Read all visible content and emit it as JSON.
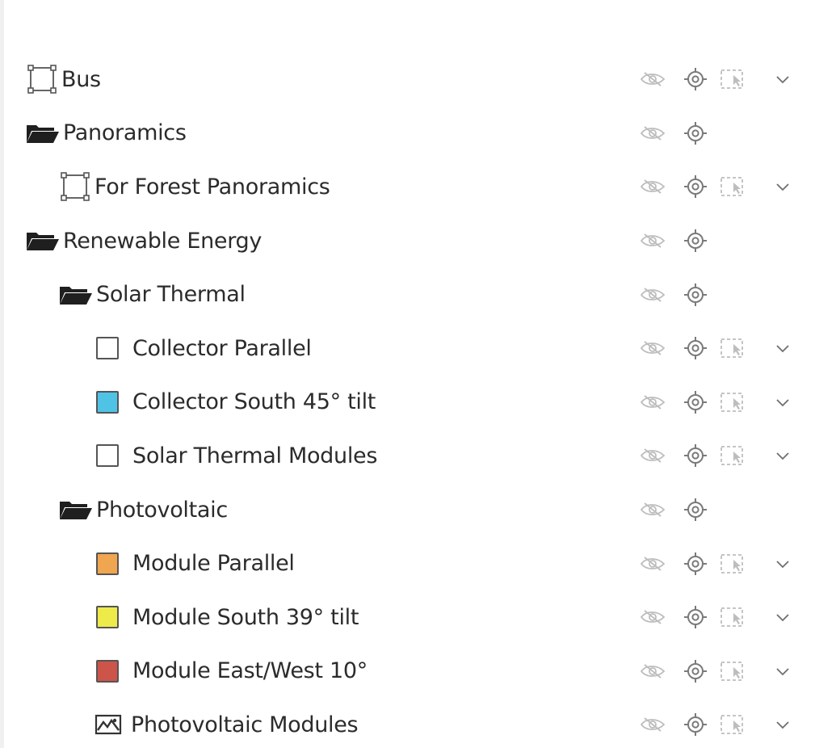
{
  "layers": [
    {
      "id": "bus",
      "label": "Bus",
      "level": 0,
      "kind": "area",
      "has_select": true,
      "has_chevron": true
    },
    {
      "id": "panoramics",
      "label": "Panoramics",
      "level": 0,
      "kind": "folder",
      "has_select": false,
      "has_chevron": false
    },
    {
      "id": "for-forest-panoramics",
      "label": "For Forest Panoramics",
      "level": 1,
      "kind": "area",
      "has_select": true,
      "has_chevron": true
    },
    {
      "id": "renewable-energy",
      "label": "Renewable Energy",
      "level": 0,
      "kind": "folder",
      "has_select": false,
      "has_chevron": false
    },
    {
      "id": "solar-thermal",
      "label": "Solar Thermal",
      "level": 1,
      "kind": "folder",
      "has_select": false,
      "has_chevron": false
    },
    {
      "id": "collector-parallel",
      "label": "Collector Parallel",
      "level": 2,
      "kind": "swatch",
      "color": "#ffffff",
      "has_select": true,
      "has_chevron": true
    },
    {
      "id": "collector-south-45-tilt",
      "label": "Collector South 45° tilt",
      "level": 2,
      "kind": "swatch",
      "color": "#4fc3e6",
      "has_select": true,
      "has_chevron": true
    },
    {
      "id": "solar-thermal-modules",
      "label": "Solar Thermal Modules",
      "level": 2,
      "kind": "swatch",
      "color": "#ffffff",
      "has_select": true,
      "has_chevron": true
    },
    {
      "id": "photovoltaic",
      "label": "Photovoltaic",
      "level": 1,
      "kind": "folder",
      "has_select": false,
      "has_chevron": false
    },
    {
      "id": "module-parallel",
      "label": "Module Parallel",
      "level": 2,
      "kind": "swatch",
      "color": "#f0a550",
      "has_select": true,
      "has_chevron": true
    },
    {
      "id": "module-south-39-tilt",
      "label": "Module South 39° tilt",
      "level": 2,
      "kind": "swatch",
      "color": "#eeea4a",
      "has_select": true,
      "has_chevron": true
    },
    {
      "id": "module-east-west-10",
      "label": "Module East/West 10°",
      "level": 2,
      "kind": "swatch",
      "color": "#cc5449",
      "has_select": true,
      "has_chevron": true
    },
    {
      "id": "photovoltaic-modules",
      "label": "Photovoltaic Modules",
      "level": 2,
      "kind": "image",
      "has_select": true,
      "has_chevron": true
    }
  ],
  "icons": {
    "folder": "folder-icon",
    "area": "area-polygon-icon",
    "image": "image-icon",
    "visibility": "eye-hidden-icon",
    "zoom": "target-icon",
    "select": "select-area-icon",
    "expand": "chevron-down-icon"
  },
  "colors": {
    "text": "#2b2b2b",
    "icon_muted": "#bdbdbd",
    "icon_mid": "#7a7a7a",
    "folder": "#1f1f1f"
  }
}
